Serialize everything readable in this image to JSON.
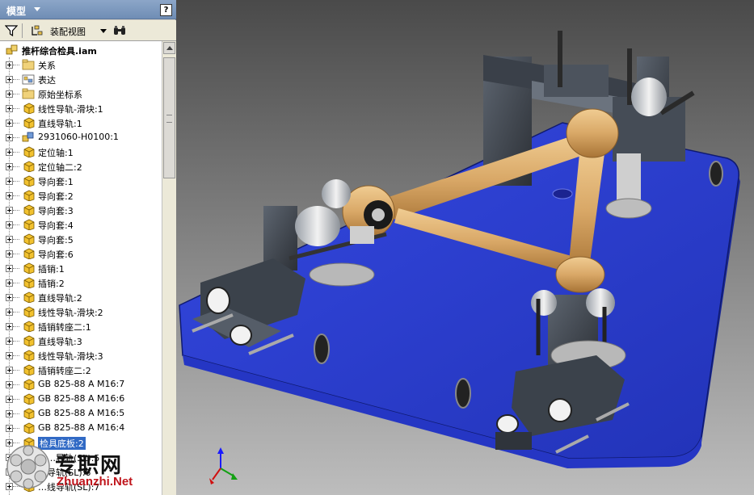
{
  "panel": {
    "title": "模型",
    "help_label": "?",
    "toolbar": {
      "view_label": "装配视图"
    }
  },
  "tree": {
    "root": {
      "label": "推杆综合检具.iam"
    },
    "items": [
      {
        "label": "关系",
        "icon": "folder-icon"
      },
      {
        "label": "表达",
        "icon": "representation-icon"
      },
      {
        "label": "原始坐标系",
        "icon": "folder-icon"
      },
      {
        "label": "线性导轨-滑块:1",
        "icon": "part-icon"
      },
      {
        "label": "直线导轨:1",
        "icon": "part-icon"
      },
      {
        "label": "2931060-H0100:1",
        "icon": "assembly-icon"
      },
      {
        "label": "定位轴:1",
        "icon": "part-icon"
      },
      {
        "label": "定位轴二:2",
        "icon": "part-icon"
      },
      {
        "label": "导向套:1",
        "icon": "part-icon"
      },
      {
        "label": "导向套:2",
        "icon": "part-icon"
      },
      {
        "label": "导向套:3",
        "icon": "part-icon"
      },
      {
        "label": "导向套:4",
        "icon": "part-icon"
      },
      {
        "label": "导向套:5",
        "icon": "part-icon"
      },
      {
        "label": "导向套:6",
        "icon": "part-icon"
      },
      {
        "label": "插销:1",
        "icon": "part-icon"
      },
      {
        "label": "插销:2",
        "icon": "part-icon"
      },
      {
        "label": "直线导轨:2",
        "icon": "part-icon"
      },
      {
        "label": "线性导轨-滑块:2",
        "icon": "part-icon"
      },
      {
        "label": "插销转座二:1",
        "icon": "part-icon"
      },
      {
        "label": "直线导轨:3",
        "icon": "part-icon"
      },
      {
        "label": "线性导轨-滑块:3",
        "icon": "part-icon"
      },
      {
        "label": "插销转座二:2",
        "icon": "part-icon"
      },
      {
        "label": "GB 825-88  A M16:7",
        "icon": "part-icon"
      },
      {
        "label": "GB 825-88  A M16:6",
        "icon": "part-icon"
      },
      {
        "label": "GB 825-88  A M16:5",
        "icon": "part-icon"
      },
      {
        "label": "GB 825-88  A M16:4",
        "icon": "part-icon"
      },
      {
        "label": "检具底板:2",
        "icon": "part-icon",
        "selected": true
      },
      {
        "label": "线…导轨(SL):5",
        "icon": "part-icon"
      },
      {
        "label": "…导轨(SL):6",
        "icon": "part-icon"
      },
      {
        "label": "…线导轨(SL):7",
        "icon": "part-icon"
      }
    ]
  },
  "watermark": {
    "text": "专职网",
    "url": "Zhuanzhi.Net"
  },
  "colors": {
    "base_plate": "#2f44d6",
    "arm": "#d9a867",
    "header": "#7a97be",
    "selection": "#316ac5"
  }
}
